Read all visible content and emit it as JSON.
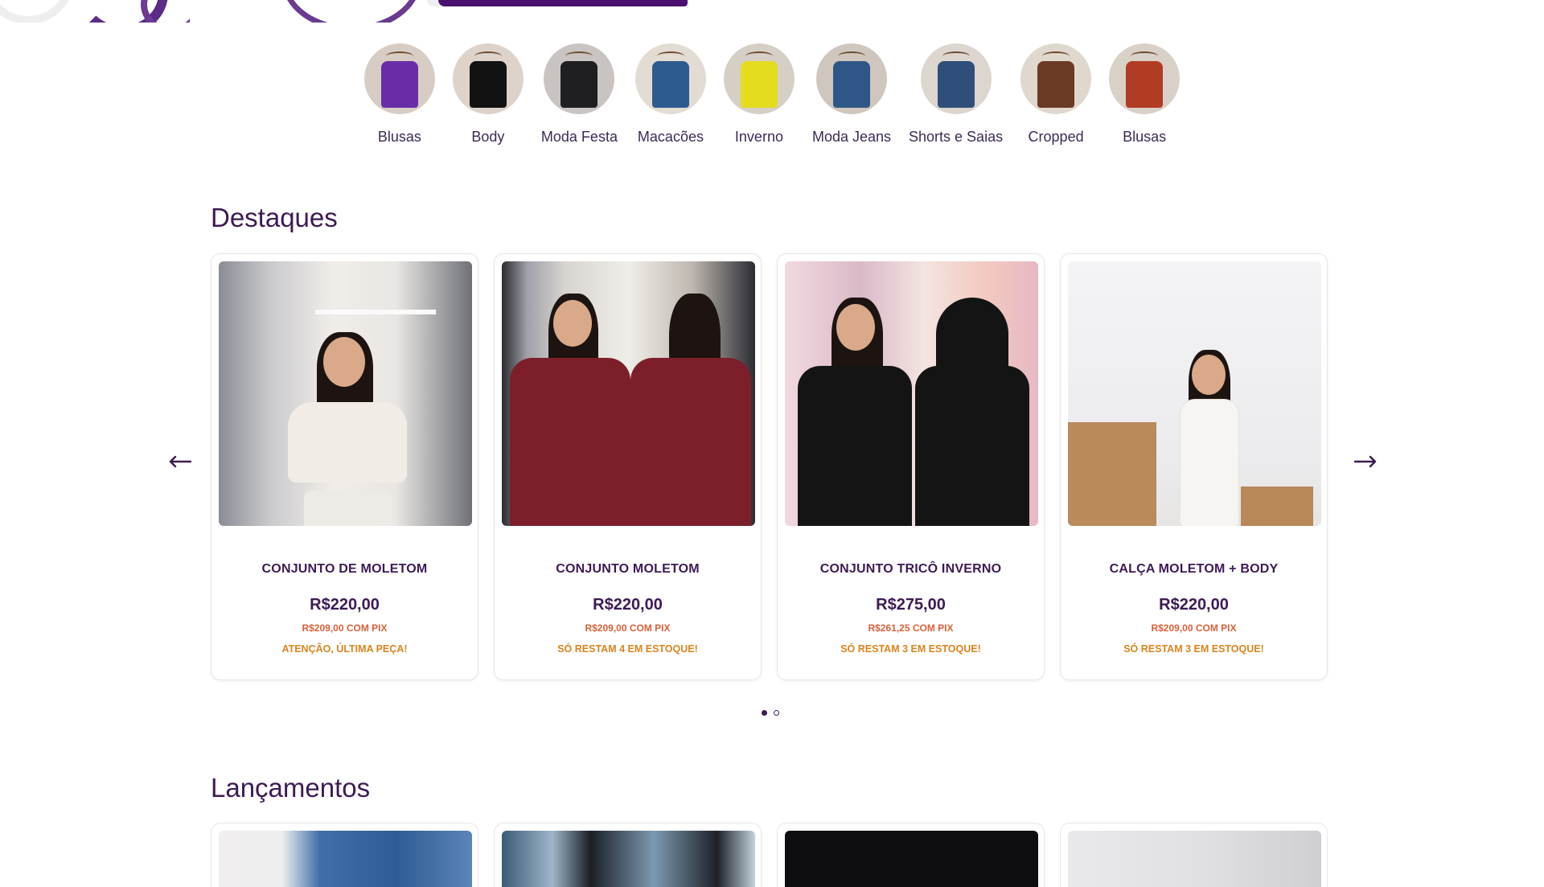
{
  "categories": [
    {
      "label": "Blusas",
      "color": "#6a2da8"
    },
    {
      "label": "Body",
      "color": "#121212"
    },
    {
      "label": "Moda Festa",
      "color": "#1f1f22"
    },
    {
      "label": "Macacões",
      "color": "#2d5b8f"
    },
    {
      "label": "Inverno",
      "color": "#e4dc1f"
    },
    {
      "label": "Moda Jeans",
      "color": "#2e5787"
    },
    {
      "label": "Shorts e Saias",
      "color": "#2f4e7a"
    },
    {
      "label": "Cropped",
      "color": "#6a3a25"
    },
    {
      "label": "Blusas",
      "color": "#b23b24"
    }
  ],
  "destaques": {
    "title": "Destaques",
    "products": [
      {
        "name": "CONJUNTO DE MOLETOM",
        "price": "R$220,00",
        "pix": "R$209,00 COM PIX",
        "stock": "ATENÇÃO, ÚLTIMA PEÇA!",
        "outfit_color": "#f1ede6"
      },
      {
        "name": "CONJUNTO MOLETOM",
        "price": "R$220,00",
        "pix": "R$209,00 COM PIX",
        "stock": "SÓ RESTAM 4 EM ESTOQUE!",
        "outfit_color": "#7d1f2b"
      },
      {
        "name": "CONJUNTO TRICÔ INVERNO",
        "price": "R$275,00",
        "pix": "R$261,25 COM PIX",
        "stock": "SÓ RESTAM 3 EM ESTOQUE!",
        "outfit_color": "#141414"
      },
      {
        "name": "CALÇA MOLETOM + BODY",
        "price": "R$220,00",
        "pix": "R$209,00 COM PIX",
        "stock": "SÓ RESTAM 3 EM ESTOQUE!",
        "outfit_color": "#f7f5f2"
      }
    ],
    "carousel_pages": 2,
    "carousel_active": 1
  },
  "lancamentos": {
    "title": "Lançamentos"
  },
  "icons": {
    "prev": "arrow-left-icon",
    "next": "arrow-right-icon"
  },
  "colors": {
    "brand": "#3d1a55",
    "pix": "#d8603a",
    "stock": "#d9841f"
  }
}
